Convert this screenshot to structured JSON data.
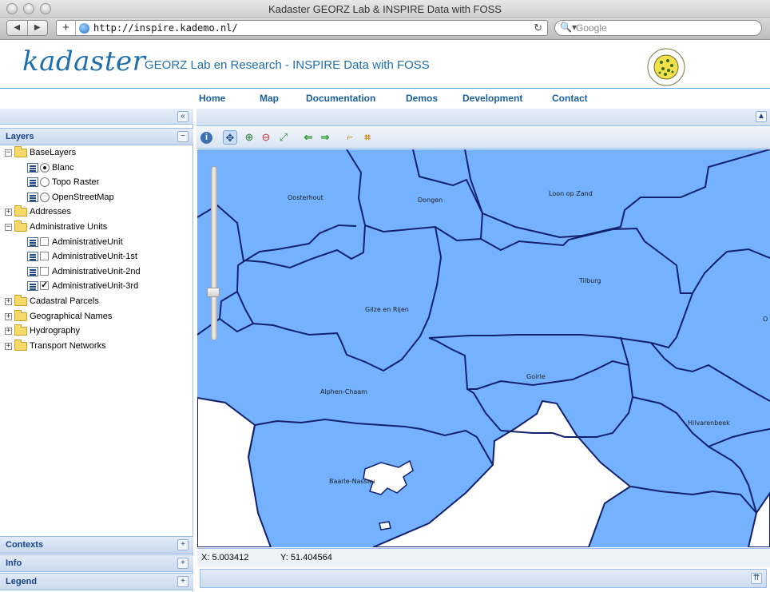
{
  "window": {
    "title": "Kadaster GEORZ Lab & INSPIRE Data with FOSS"
  },
  "browser": {
    "url": "http://inspire.kademo.nl/",
    "search_placeholder": "Google",
    "back_glyph": "◀",
    "forward_glyph": "▶",
    "add_glyph": "+",
    "reload_glyph": "↻",
    "search_glyph": "🔍▾"
  },
  "header": {
    "logo": "kadaster",
    "subtitle": "GEORZ Lab en Research - INSPIRE Data with FOSS",
    "brand_color": "#1f6fad"
  },
  "menu": [
    "Home",
    "Map",
    "Documentation",
    "Demos",
    "Development",
    "Contact"
  ],
  "west": {
    "collapse_glyph": "«",
    "layers_title": "Layers",
    "minus_glyph": "−",
    "tree": [
      {
        "label": "BaseLayers",
        "kind": "folder",
        "toggle": "−",
        "depth": 0
      },
      {
        "label": "Blanc",
        "kind": "radio",
        "checked": true,
        "depth": 1
      },
      {
        "label": "Topo Raster",
        "kind": "radio",
        "checked": false,
        "depth": 1
      },
      {
        "label": "OpenStreetMap",
        "kind": "radio",
        "checked": false,
        "depth": 1
      },
      {
        "label": "Addresses",
        "kind": "folder",
        "toggle": "+",
        "depth": 0
      },
      {
        "label": "Administrative Units",
        "kind": "folder",
        "toggle": "−",
        "depth": 0
      },
      {
        "label": "AdministrativeUnit",
        "kind": "check",
        "checked": false,
        "depth": 1
      },
      {
        "label": "AdministrativeUnit-1st",
        "kind": "check",
        "checked": false,
        "depth": 1
      },
      {
        "label": "AdministrativeUnit-2nd",
        "kind": "check",
        "checked": false,
        "depth": 1
      },
      {
        "label": "AdministrativeUnit-3rd",
        "kind": "check",
        "checked": true,
        "depth": 1
      },
      {
        "label": "Cadastral Parcels",
        "kind": "folder",
        "toggle": "+",
        "depth": 0
      },
      {
        "label": "Geographical Names",
        "kind": "folder",
        "toggle": "+",
        "depth": 0
      },
      {
        "label": "Hydrography",
        "kind": "folder",
        "toggle": "+",
        "depth": 0
      },
      {
        "label": "Transport Networks",
        "kind": "folder",
        "toggle": "+",
        "depth": 0
      }
    ],
    "panels": [
      "Contexts",
      "Info",
      "Legend"
    ],
    "plus_glyph": "+"
  },
  "map": {
    "fill_color": "#74b2ff",
    "line_color": "#12206e",
    "labels": [
      "Oosterhout",
      "Dongen",
      "Loon op Zand",
      "Tilburg",
      "Gilze en Rijen",
      "O",
      "Goirle",
      "Alphen-Chaam",
      "Hilvarenbeek",
      "Baarle-Nassau"
    ],
    "toolbar_icons": [
      "info-icon",
      "pan-icon",
      "zoom-in-icon",
      "zoom-out-icon",
      "zoom-extent-icon",
      "history-back-icon",
      "history-forward-icon",
      "measure-line-icon",
      "measure-area-icon"
    ],
    "expand_glyph": "▲",
    "south_glyph": "⇈"
  },
  "coords": {
    "x": "X: 5.003412",
    "y": "Y: 51.404564"
  }
}
